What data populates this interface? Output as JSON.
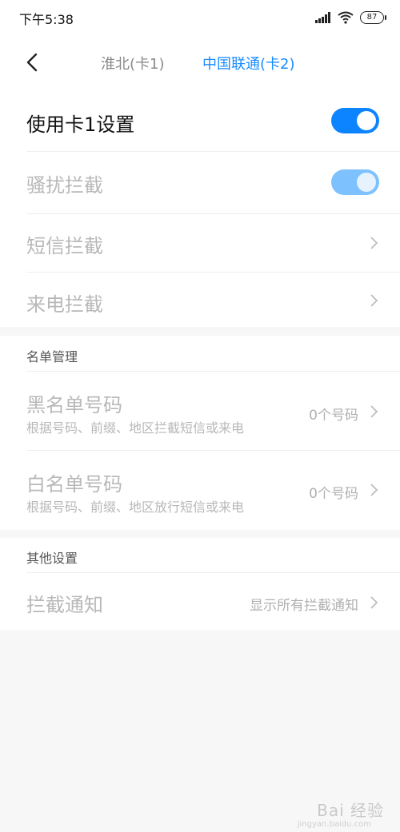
{
  "status_bar": {
    "time": "下午5:38",
    "battery": "87",
    "icons": [
      "signal-icon",
      "wifi-icon",
      "battery-icon"
    ]
  },
  "header": {
    "tabs": [
      {
        "label": "淮北(卡1)",
        "active": false
      },
      {
        "label": "中国联通(卡2)",
        "active": true
      }
    ],
    "accent_color": "#1a8cff"
  },
  "settings": {
    "use_card1": {
      "label": "使用卡1设置",
      "on": true
    },
    "harassment_block": {
      "label": "骚扰拦截",
      "on": true,
      "disabled": true
    },
    "sms_block": {
      "label": "短信拦截"
    },
    "call_block": {
      "label": "来电拦截"
    }
  },
  "list_management": {
    "title": "名单管理",
    "blacklist": {
      "label": "黑名单号码",
      "desc": "根据号码、前缀、地区拦截短信或来电",
      "value": "0个号码"
    },
    "whitelist": {
      "label": "白名单号码",
      "desc": "根据号码、前缀、地区放行短信或来电",
      "value": "0个号码"
    }
  },
  "other_settings": {
    "title": "其他设置",
    "block_notification": {
      "label": "拦截通知",
      "value": "显示所有拦截通知"
    }
  },
  "watermark": {
    "brand": "Bai 经验",
    "url": "jingyan.baidu.com"
  }
}
